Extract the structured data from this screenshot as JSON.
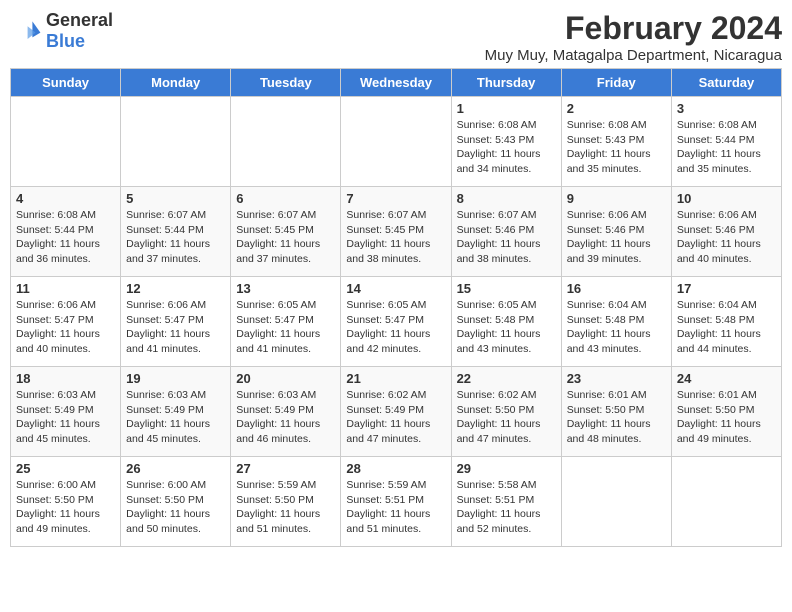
{
  "logo": {
    "general": "General",
    "blue": "Blue"
  },
  "title": "February 2024",
  "subtitle": "Muy Muy, Matagalpa Department, Nicaragua",
  "headers": [
    "Sunday",
    "Monday",
    "Tuesday",
    "Wednesday",
    "Thursday",
    "Friday",
    "Saturday"
  ],
  "weeks": [
    [
      {
        "day": "",
        "content": ""
      },
      {
        "day": "",
        "content": ""
      },
      {
        "day": "",
        "content": ""
      },
      {
        "day": "",
        "content": ""
      },
      {
        "day": "1",
        "content": "Sunrise: 6:08 AM\nSunset: 5:43 PM\nDaylight: 11 hours\nand 34 minutes."
      },
      {
        "day": "2",
        "content": "Sunrise: 6:08 AM\nSunset: 5:43 PM\nDaylight: 11 hours\nand 35 minutes."
      },
      {
        "day": "3",
        "content": "Sunrise: 6:08 AM\nSunset: 5:44 PM\nDaylight: 11 hours\nand 35 minutes."
      }
    ],
    [
      {
        "day": "4",
        "content": "Sunrise: 6:08 AM\nSunset: 5:44 PM\nDaylight: 11 hours\nand 36 minutes."
      },
      {
        "day": "5",
        "content": "Sunrise: 6:07 AM\nSunset: 5:44 PM\nDaylight: 11 hours\nand 37 minutes."
      },
      {
        "day": "6",
        "content": "Sunrise: 6:07 AM\nSunset: 5:45 PM\nDaylight: 11 hours\nand 37 minutes."
      },
      {
        "day": "7",
        "content": "Sunrise: 6:07 AM\nSunset: 5:45 PM\nDaylight: 11 hours\nand 38 minutes."
      },
      {
        "day": "8",
        "content": "Sunrise: 6:07 AM\nSunset: 5:46 PM\nDaylight: 11 hours\nand 38 minutes."
      },
      {
        "day": "9",
        "content": "Sunrise: 6:06 AM\nSunset: 5:46 PM\nDaylight: 11 hours\nand 39 minutes."
      },
      {
        "day": "10",
        "content": "Sunrise: 6:06 AM\nSunset: 5:46 PM\nDaylight: 11 hours\nand 40 minutes."
      }
    ],
    [
      {
        "day": "11",
        "content": "Sunrise: 6:06 AM\nSunset: 5:47 PM\nDaylight: 11 hours\nand 40 minutes."
      },
      {
        "day": "12",
        "content": "Sunrise: 6:06 AM\nSunset: 5:47 PM\nDaylight: 11 hours\nand 41 minutes."
      },
      {
        "day": "13",
        "content": "Sunrise: 6:05 AM\nSunset: 5:47 PM\nDaylight: 11 hours\nand 41 minutes."
      },
      {
        "day": "14",
        "content": "Sunrise: 6:05 AM\nSunset: 5:47 PM\nDaylight: 11 hours\nand 42 minutes."
      },
      {
        "day": "15",
        "content": "Sunrise: 6:05 AM\nSunset: 5:48 PM\nDaylight: 11 hours\nand 43 minutes."
      },
      {
        "day": "16",
        "content": "Sunrise: 6:04 AM\nSunset: 5:48 PM\nDaylight: 11 hours\nand 43 minutes."
      },
      {
        "day": "17",
        "content": "Sunrise: 6:04 AM\nSunset: 5:48 PM\nDaylight: 11 hours\nand 44 minutes."
      }
    ],
    [
      {
        "day": "18",
        "content": "Sunrise: 6:03 AM\nSunset: 5:49 PM\nDaylight: 11 hours\nand 45 minutes."
      },
      {
        "day": "19",
        "content": "Sunrise: 6:03 AM\nSunset: 5:49 PM\nDaylight: 11 hours\nand 45 minutes."
      },
      {
        "day": "20",
        "content": "Sunrise: 6:03 AM\nSunset: 5:49 PM\nDaylight: 11 hours\nand 46 minutes."
      },
      {
        "day": "21",
        "content": "Sunrise: 6:02 AM\nSunset: 5:49 PM\nDaylight: 11 hours\nand 47 minutes."
      },
      {
        "day": "22",
        "content": "Sunrise: 6:02 AM\nSunset: 5:50 PM\nDaylight: 11 hours\nand 47 minutes."
      },
      {
        "day": "23",
        "content": "Sunrise: 6:01 AM\nSunset: 5:50 PM\nDaylight: 11 hours\nand 48 minutes."
      },
      {
        "day": "24",
        "content": "Sunrise: 6:01 AM\nSunset: 5:50 PM\nDaylight: 11 hours\nand 49 minutes."
      }
    ],
    [
      {
        "day": "25",
        "content": "Sunrise: 6:00 AM\nSunset: 5:50 PM\nDaylight: 11 hours\nand 49 minutes."
      },
      {
        "day": "26",
        "content": "Sunrise: 6:00 AM\nSunset: 5:50 PM\nDaylight: 11 hours\nand 50 minutes."
      },
      {
        "day": "27",
        "content": "Sunrise: 5:59 AM\nSunset: 5:50 PM\nDaylight: 11 hours\nand 51 minutes."
      },
      {
        "day": "28",
        "content": "Sunrise: 5:59 AM\nSunset: 5:51 PM\nDaylight: 11 hours\nand 51 minutes."
      },
      {
        "day": "29",
        "content": "Sunrise: 5:58 AM\nSunset: 5:51 PM\nDaylight: 11 hours\nand 52 minutes."
      },
      {
        "day": "",
        "content": ""
      },
      {
        "day": "",
        "content": ""
      }
    ]
  ]
}
